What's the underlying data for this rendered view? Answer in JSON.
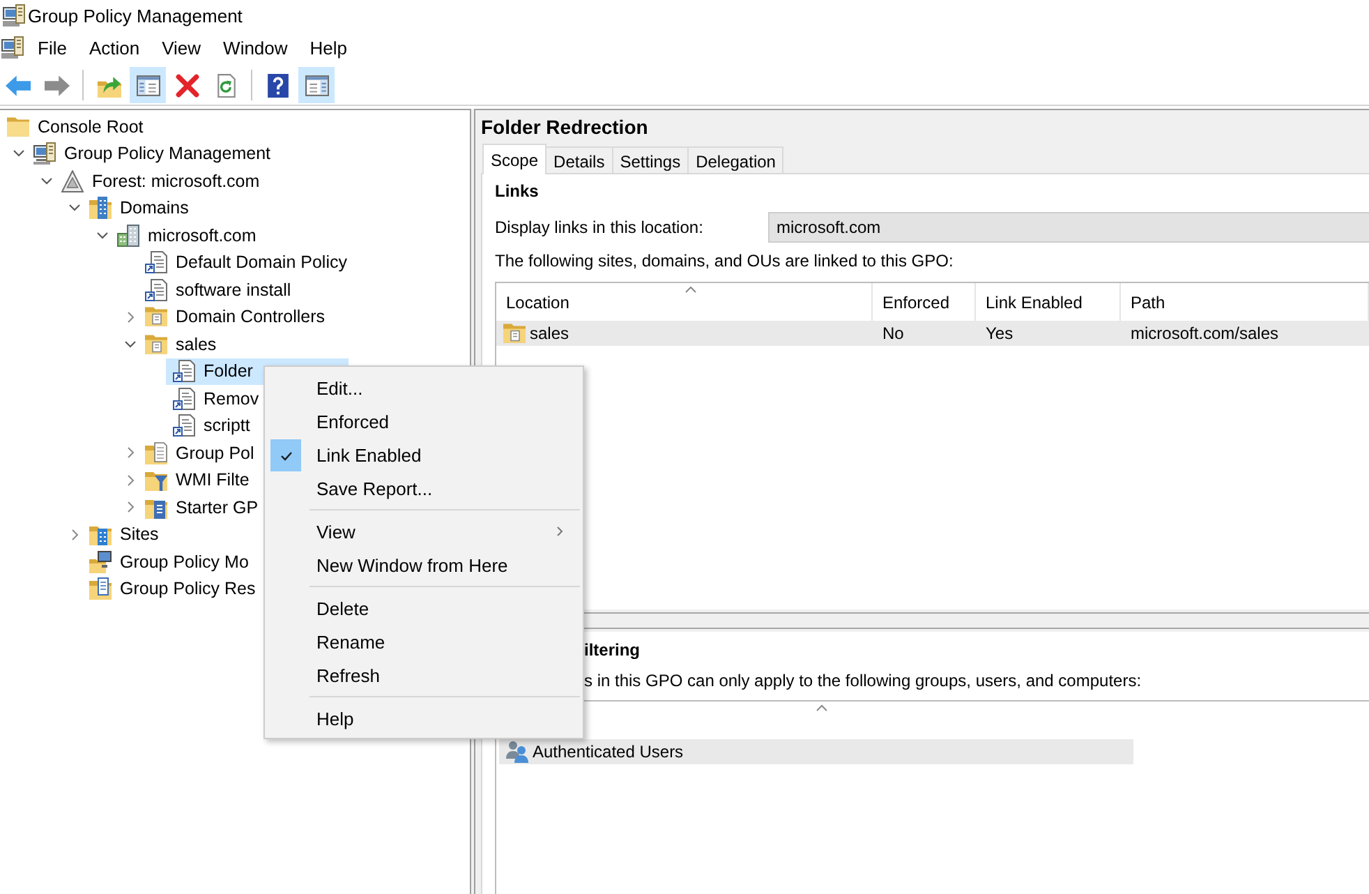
{
  "window": {
    "title": "Group Policy Management"
  },
  "menu_bar": [
    "File",
    "Action",
    "View",
    "Window",
    "Help"
  ],
  "toolbar": {
    "groups": [
      [
        {
          "kind": "back",
          "disabled": false,
          "pressed": false
        },
        {
          "kind": "forward",
          "disabled": true,
          "pressed": false
        }
      ],
      [
        {
          "kind": "up",
          "disabled": false,
          "pressed": false
        },
        {
          "kind": "tree",
          "disabled": false,
          "pressed": true
        },
        {
          "kind": "delete",
          "disabled": false,
          "pressed": false
        },
        {
          "kind": "refresh",
          "disabled": false,
          "pressed": false
        }
      ],
      [
        {
          "kind": "help",
          "disabled": false,
          "pressed": false
        },
        {
          "kind": "action-pane",
          "disabled": false,
          "pressed": true
        }
      ]
    ]
  },
  "tree": [
    {
      "label": "Console Root",
      "kind": "folder",
      "selected": false,
      "children": [
        {
          "label": "Group Policy Management",
          "kind": "console",
          "expanded": true,
          "selected": false,
          "children": [
            {
              "label": "Forest: microsoft.com",
              "kind": "forest",
              "expanded": true,
              "selected": false,
              "children": [
                {
                  "label": "Domains",
                  "kind": "domains",
                  "expanded": true,
                  "selected": false,
                  "children": [
                    {
                      "label": "microsoft.com",
                      "kind": "domain",
                      "expanded": true,
                      "selected": false,
                      "children": [
                        {
                          "label": "Default Domain Policy",
                          "kind": "gpo-link",
                          "selected": false
                        },
                        {
                          "label": "software install",
                          "kind": "gpo-link",
                          "selected": false
                        },
                        {
                          "label": "Domain Controllers",
                          "kind": "ou",
                          "expanded": false,
                          "selected": false
                        },
                        {
                          "label": "sales",
                          "kind": "ou",
                          "expanded": true,
                          "selected": false,
                          "children": [
                            {
                              "label": "Folder",
                              "kind": "gpo-link",
                              "selected": true
                            },
                            {
                              "label": "Remov",
                              "kind": "gpo-link",
                              "selected": false
                            },
                            {
                              "label": "scriptt",
                              "kind": "gpo-link",
                              "selected": false
                            }
                          ]
                        },
                        {
                          "label": "Group Pol",
                          "kind": "gpo-folder",
                          "expanded": false,
                          "selected": false
                        },
                        {
                          "label": "WMI Filte",
                          "kind": "wmi-folder",
                          "expanded": false,
                          "selected": false
                        },
                        {
                          "label": "Starter GP",
                          "kind": "starter-folder",
                          "expanded": false,
                          "selected": false
                        }
                      ]
                    }
                  ]
                },
                {
                  "label": "Sites",
                  "kind": "sites",
                  "expanded": false,
                  "selected": false
                },
                {
                  "label": "Group Policy Mo",
                  "kind": "modeling",
                  "selected": false
                },
                {
                  "label": "Group Policy Res",
                  "kind": "results",
                  "selected": false
                }
              ]
            }
          ]
        }
      ]
    }
  ],
  "details_pane": {
    "title": "Folder Redrection",
    "tabs": [
      {
        "label": "Scope",
        "selected": true
      },
      {
        "label": "Details",
        "selected": false
      },
      {
        "label": "Settings",
        "selected": false
      },
      {
        "label": "Delegation",
        "selected": false
      }
    ],
    "links": {
      "heading": "Links",
      "location_label": "Display links in this location:",
      "location_value": "microsoft.com",
      "caption": "The following sites, domains, and OUs are linked to this GPO:",
      "table": {
        "columns": [
          {
            "label": "Location",
            "sorted": true
          },
          {
            "label": "Enforced",
            "sorted": false
          },
          {
            "label": "Link Enabled",
            "sorted": false
          },
          {
            "label": "Path",
            "sorted": false
          }
        ],
        "rows": [
          {
            "cells": [
              "sales",
              "No",
              "Yes",
              "microsoft.com/sales"
            ],
            "selected": true
          }
        ]
      }
    },
    "security_filtering": {
      "heading": "iltering",
      "caption": "s in this GPO can only apply to the following groups, users, and computers:",
      "table": {
        "columns": [
          {
            "sorted": true
          }
        ],
        "rows": [
          {
            "cells": [
              "Authenticated Users"
            ],
            "selected": true
          }
        ]
      }
    }
  },
  "context_menu": {
    "groups": [
      [
        {
          "label": "Edit...",
          "checked": false,
          "submenu": false
        },
        {
          "label": "Enforced",
          "checked": false,
          "submenu": false
        },
        {
          "label": "Link Enabled",
          "checked": true,
          "submenu": false
        },
        {
          "label": "Save Report...",
          "checked": false,
          "submenu": false
        }
      ],
      [
        {
          "label": "View",
          "checked": false,
          "submenu": true
        },
        {
          "label": "New Window from Here",
          "checked": false,
          "submenu": false
        }
      ],
      [
        {
          "label": "Delete",
          "checked": false,
          "submenu": false
        },
        {
          "label": "Rename",
          "checked": false,
          "submenu": false
        },
        {
          "label": "Refresh",
          "checked": false,
          "submenu": false
        }
      ],
      [
        {
          "label": "Help",
          "checked": false,
          "submenu": false
        }
      ]
    ]
  }
}
